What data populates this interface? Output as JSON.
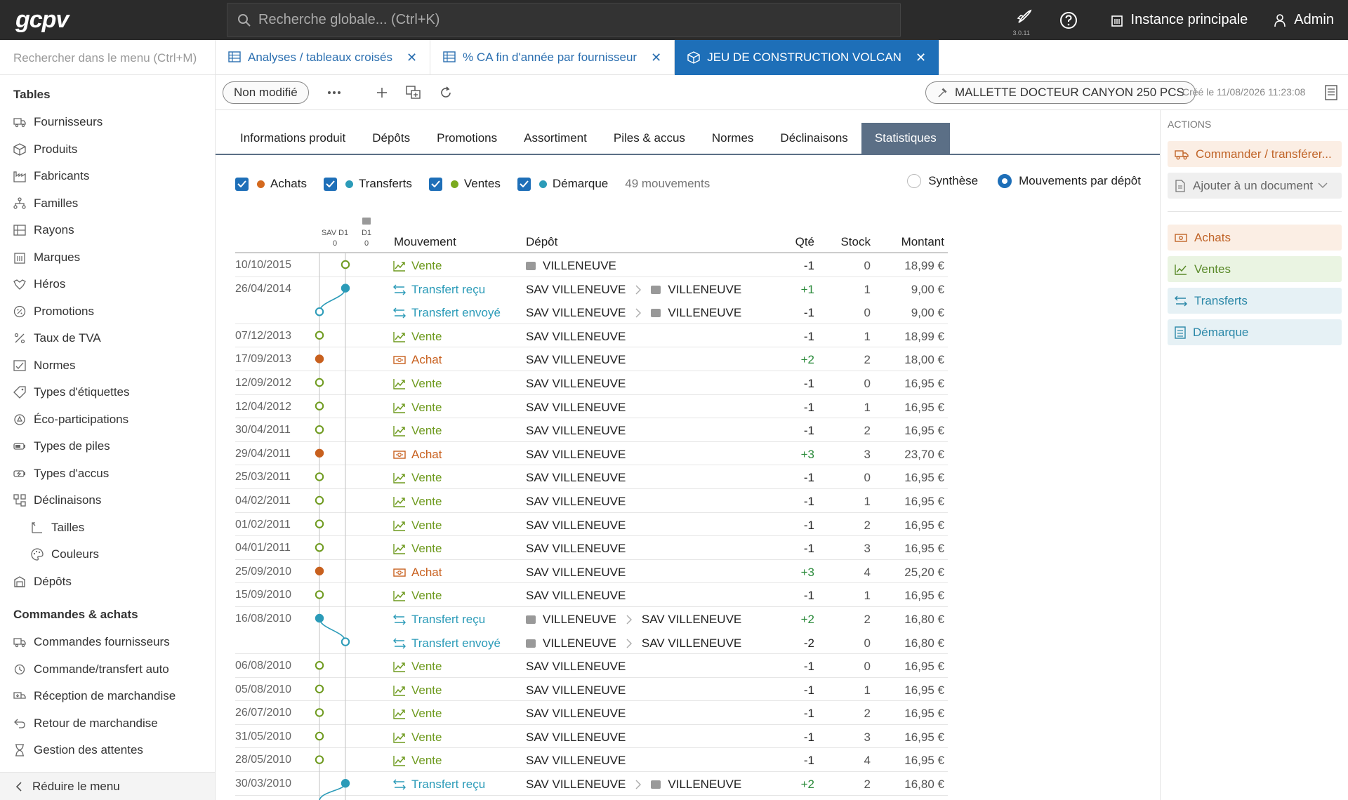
{
  "app": {
    "logo_text": "gcpv",
    "search_placeholder": "Recherche globale... (Ctrl+K)",
    "version": "3.0.11",
    "instance_label": "Instance principale",
    "user_label": "Admin"
  },
  "sidebar": {
    "search_placeholder": "Rechercher dans le menu (Ctrl+M)",
    "section_tables": "Tables",
    "tables": [
      {
        "label": "Fournisseurs",
        "icon": "truck-icon"
      },
      {
        "label": "Produits",
        "icon": "box-icon"
      },
      {
        "label": "Fabricants",
        "icon": "factory-icon"
      },
      {
        "label": "Familles",
        "icon": "hierarchy-icon"
      },
      {
        "label": "Rayons",
        "icon": "shelf-icon"
      },
      {
        "label": "Marques",
        "icon": "building-icon"
      },
      {
        "label": "Héros",
        "icon": "hero-icon"
      },
      {
        "label": "Promotions",
        "icon": "percent-badge-icon"
      },
      {
        "label": "Taux de TVA",
        "icon": "percent-icon"
      },
      {
        "label": "Normes",
        "icon": "norm-icon"
      },
      {
        "label": "Types d'étiquettes",
        "icon": "tag-icon"
      },
      {
        "label": "Éco-participations",
        "icon": "recycle-icon"
      },
      {
        "label": "Types de piles",
        "icon": "battery-icon"
      },
      {
        "label": "Types d'accus",
        "icon": "battery-charge-icon"
      },
      {
        "label": "Déclinaisons",
        "icon": "variants-icon"
      }
    ],
    "sub_items": [
      {
        "label": "Tailles",
        "icon": "size-icon"
      },
      {
        "label": "Couleurs",
        "icon": "palette-icon"
      }
    ],
    "depots": {
      "label": "Dépôts",
      "icon": "warehouse-icon"
    },
    "section_commandes": "Commandes & achats",
    "commandes": [
      {
        "label": "Commandes fournisseurs",
        "icon": "truck-icon"
      },
      {
        "label": "Commande/transfert auto",
        "icon": "auto-icon"
      },
      {
        "label": "Réception de marchandise",
        "icon": "reception-icon"
      },
      {
        "label": "Retour de marchandise",
        "icon": "return-icon"
      },
      {
        "label": "Gestion des attentes",
        "icon": "hourglass-icon"
      }
    ],
    "collapse_label": "Réduire le menu"
  },
  "tabs": [
    {
      "label": "Analyses / tableaux croisés",
      "icon": "table-icon",
      "active": false
    },
    {
      "label": "% CA fin d'année par fournisseur",
      "icon": "table-icon",
      "active": false
    },
    {
      "label": "JEU DE CONSTRUCTION VOLCAN",
      "icon": "box-icon",
      "active": true
    }
  ],
  "toolbar": {
    "status": "Non modifié",
    "product": "MALLETTE DOCTEUR CANYON 250 PCS",
    "created": "Créé le 11/08/2026 11:23:08"
  },
  "subtabs": [
    {
      "label": "Informations produit",
      "active": false
    },
    {
      "label": "Dépôts",
      "active": false
    },
    {
      "label": "Promotions",
      "active": false
    },
    {
      "label": "Assortiment",
      "active": false
    },
    {
      "label": "Piles & accus",
      "active": false
    },
    {
      "label": "Normes",
      "active": false
    },
    {
      "label": "Déclinaisons",
      "active": false
    },
    {
      "label": "Statistiques",
      "active": true
    }
  ],
  "filters": {
    "checks": [
      {
        "label": "Achats",
        "color": "#d4691e",
        "checked": true
      },
      {
        "label": "Transferts",
        "color": "#2b9bb8",
        "checked": true
      },
      {
        "label": "Ventes",
        "color": "#7aaa1e",
        "checked": true
      },
      {
        "label": "Démarque",
        "color": "#2b9bb8",
        "checked": true
      }
    ],
    "count": "49 mouvements",
    "radio_synthese": "Synthèse",
    "radio_depot": "Mouvements par dépôt",
    "radio_selected": "Mouvements par dépôt"
  },
  "timeline_header": {
    "col1_label": "SAV D1",
    "col1_value": "0",
    "col2_label": "D1",
    "col2_value": "0"
  },
  "table": {
    "headers": {
      "mouvement": "Mouvement",
      "depot": "Dépôt",
      "qte": "Qté",
      "stock": "Stock",
      "montant": "Montant"
    },
    "rows": [
      {
        "date": "10/10/2015",
        "type": "Vente",
        "depot": "VILLENEUVE",
        "depot_wh": true,
        "dest": "",
        "qty": "-1",
        "stock": "0",
        "amount": "18,99 €",
        "lane": 2
      },
      {
        "date": "26/04/2014",
        "type": "Transfert reçu",
        "depot": "SAV VILLENEUVE",
        "depot_wh": false,
        "dest": "VILLENEUVE",
        "qty": "+1",
        "stock": "1",
        "amount": "9,00 €",
        "lane": 2,
        "pair": "top"
      },
      {
        "date": "",
        "type": "Transfert envoyé",
        "depot": "SAV VILLENEUVE",
        "depot_wh": false,
        "dest": "VILLENEUVE",
        "qty": "-1",
        "stock": "0",
        "amount": "9,00 €",
        "lane": 1,
        "pair": "bottom"
      },
      {
        "date": "07/12/2013",
        "type": "Vente",
        "depot": "SAV VILLENEUVE",
        "depot_wh": false,
        "dest": "",
        "qty": "-1",
        "stock": "1",
        "amount": "18,99 €",
        "lane": 1
      },
      {
        "date": "17/09/2013",
        "type": "Achat",
        "depot": "SAV VILLENEUVE",
        "depot_wh": false,
        "dest": "",
        "qty": "+2",
        "stock": "2",
        "amount": "18,00 €",
        "lane": 1
      },
      {
        "date": "12/09/2012",
        "type": "Vente",
        "depot": "SAV VILLENEUVE",
        "depot_wh": false,
        "dest": "",
        "qty": "-1",
        "stock": "0",
        "amount": "16,95 €",
        "lane": 1
      },
      {
        "date": "12/04/2012",
        "type": "Vente",
        "depot": "SAV VILLENEUVE",
        "depot_wh": false,
        "dest": "",
        "qty": "-1",
        "stock": "1",
        "amount": "16,95 €",
        "lane": 1
      },
      {
        "date": "30/04/2011",
        "type": "Vente",
        "depot": "SAV VILLENEUVE",
        "depot_wh": false,
        "dest": "",
        "qty": "-1",
        "stock": "2",
        "amount": "16,95 €",
        "lane": 1
      },
      {
        "date": "29/04/2011",
        "type": "Achat",
        "depot": "SAV VILLENEUVE",
        "depot_wh": false,
        "dest": "",
        "qty": "+3",
        "stock": "3",
        "amount": "23,70 €",
        "lane": 1
      },
      {
        "date": "25/03/2011",
        "type": "Vente",
        "depot": "SAV VILLENEUVE",
        "depot_wh": false,
        "dest": "",
        "qty": "-1",
        "stock": "0",
        "amount": "16,95 €",
        "lane": 1
      },
      {
        "date": "04/02/2011",
        "type": "Vente",
        "depot": "SAV VILLENEUVE",
        "depot_wh": false,
        "dest": "",
        "qty": "-1",
        "stock": "1",
        "amount": "16,95 €",
        "lane": 1
      },
      {
        "date": "01/02/2011",
        "type": "Vente",
        "depot": "SAV VILLENEUVE",
        "depot_wh": false,
        "dest": "",
        "qty": "-1",
        "stock": "2",
        "amount": "16,95 €",
        "lane": 1
      },
      {
        "date": "04/01/2011",
        "type": "Vente",
        "depot": "SAV VILLENEUVE",
        "depot_wh": false,
        "dest": "",
        "qty": "-1",
        "stock": "3",
        "amount": "16,95 €",
        "lane": 1
      },
      {
        "date": "25/09/2010",
        "type": "Achat",
        "depot": "SAV VILLENEUVE",
        "depot_wh": false,
        "dest": "",
        "qty": "+3",
        "stock": "4",
        "amount": "25,20 €",
        "lane": 1
      },
      {
        "date": "15/09/2010",
        "type": "Vente",
        "depot": "SAV VILLENEUVE",
        "depot_wh": false,
        "dest": "",
        "qty": "-1",
        "stock": "1",
        "amount": "16,95 €",
        "lane": 1
      },
      {
        "date": "16/08/2010",
        "type": "Transfert reçu",
        "depot": "VILLENEUVE",
        "depot_wh": true,
        "dest": "SAV VILLENEUVE",
        "qty": "+2",
        "stock": "2",
        "amount": "16,80 €",
        "lane": 1,
        "pair": "top"
      },
      {
        "date": "",
        "type": "Transfert envoyé",
        "depot": "VILLENEUVE",
        "depot_wh": true,
        "dest": "SAV VILLENEUVE",
        "qty": "-2",
        "stock": "0",
        "amount": "16,80 €",
        "lane": 2,
        "pair": "bottom"
      },
      {
        "date": "06/08/2010",
        "type": "Vente",
        "depot": "SAV VILLENEUVE",
        "depot_wh": false,
        "dest": "",
        "qty": "-1",
        "stock": "0",
        "amount": "16,95 €",
        "lane": 1
      },
      {
        "date": "05/08/2010",
        "type": "Vente",
        "depot": "SAV VILLENEUVE",
        "depot_wh": false,
        "dest": "",
        "qty": "-1",
        "stock": "1",
        "amount": "16,95 €",
        "lane": 1
      },
      {
        "date": "26/07/2010",
        "type": "Vente",
        "depot": "SAV VILLENEUVE",
        "depot_wh": false,
        "dest": "",
        "qty": "-1",
        "stock": "2",
        "amount": "16,95 €",
        "lane": 1
      },
      {
        "date": "31/05/2010",
        "type": "Vente",
        "depot": "SAV VILLENEUVE",
        "depot_wh": false,
        "dest": "",
        "qty": "-1",
        "stock": "3",
        "amount": "16,95 €",
        "lane": 1
      },
      {
        "date": "28/05/2010",
        "type": "Vente",
        "depot": "SAV VILLENEUVE",
        "depot_wh": false,
        "dest": "",
        "qty": "-1",
        "stock": "4",
        "amount": "16,95 €",
        "lane": 1
      },
      {
        "date": "30/03/2010",
        "type": "Transfert reçu",
        "depot": "SAV VILLENEUVE",
        "depot_wh": false,
        "dest": "VILLENEUVE",
        "qty": "+2",
        "stock": "2",
        "amount": "16,80 €",
        "lane": 2
      }
    ]
  },
  "colors": {
    "vente": "#6e9a1e",
    "achat": "#c8601e",
    "transfert": "#2b9bb8",
    "accent": "#1e6fb8",
    "subtab_active": "#5b6f86"
  },
  "actions": {
    "title": "ACTIONS",
    "order_label": "Commander / transférer...",
    "adddoc_label": "Ajouter à un document",
    "links": [
      {
        "label": "Achats",
        "kind": "achats"
      },
      {
        "label": "Ventes",
        "kind": "ventes"
      },
      {
        "label": "Transferts",
        "kind": "transferts"
      },
      {
        "label": "Démarque",
        "kind": "demarque"
      }
    ]
  }
}
